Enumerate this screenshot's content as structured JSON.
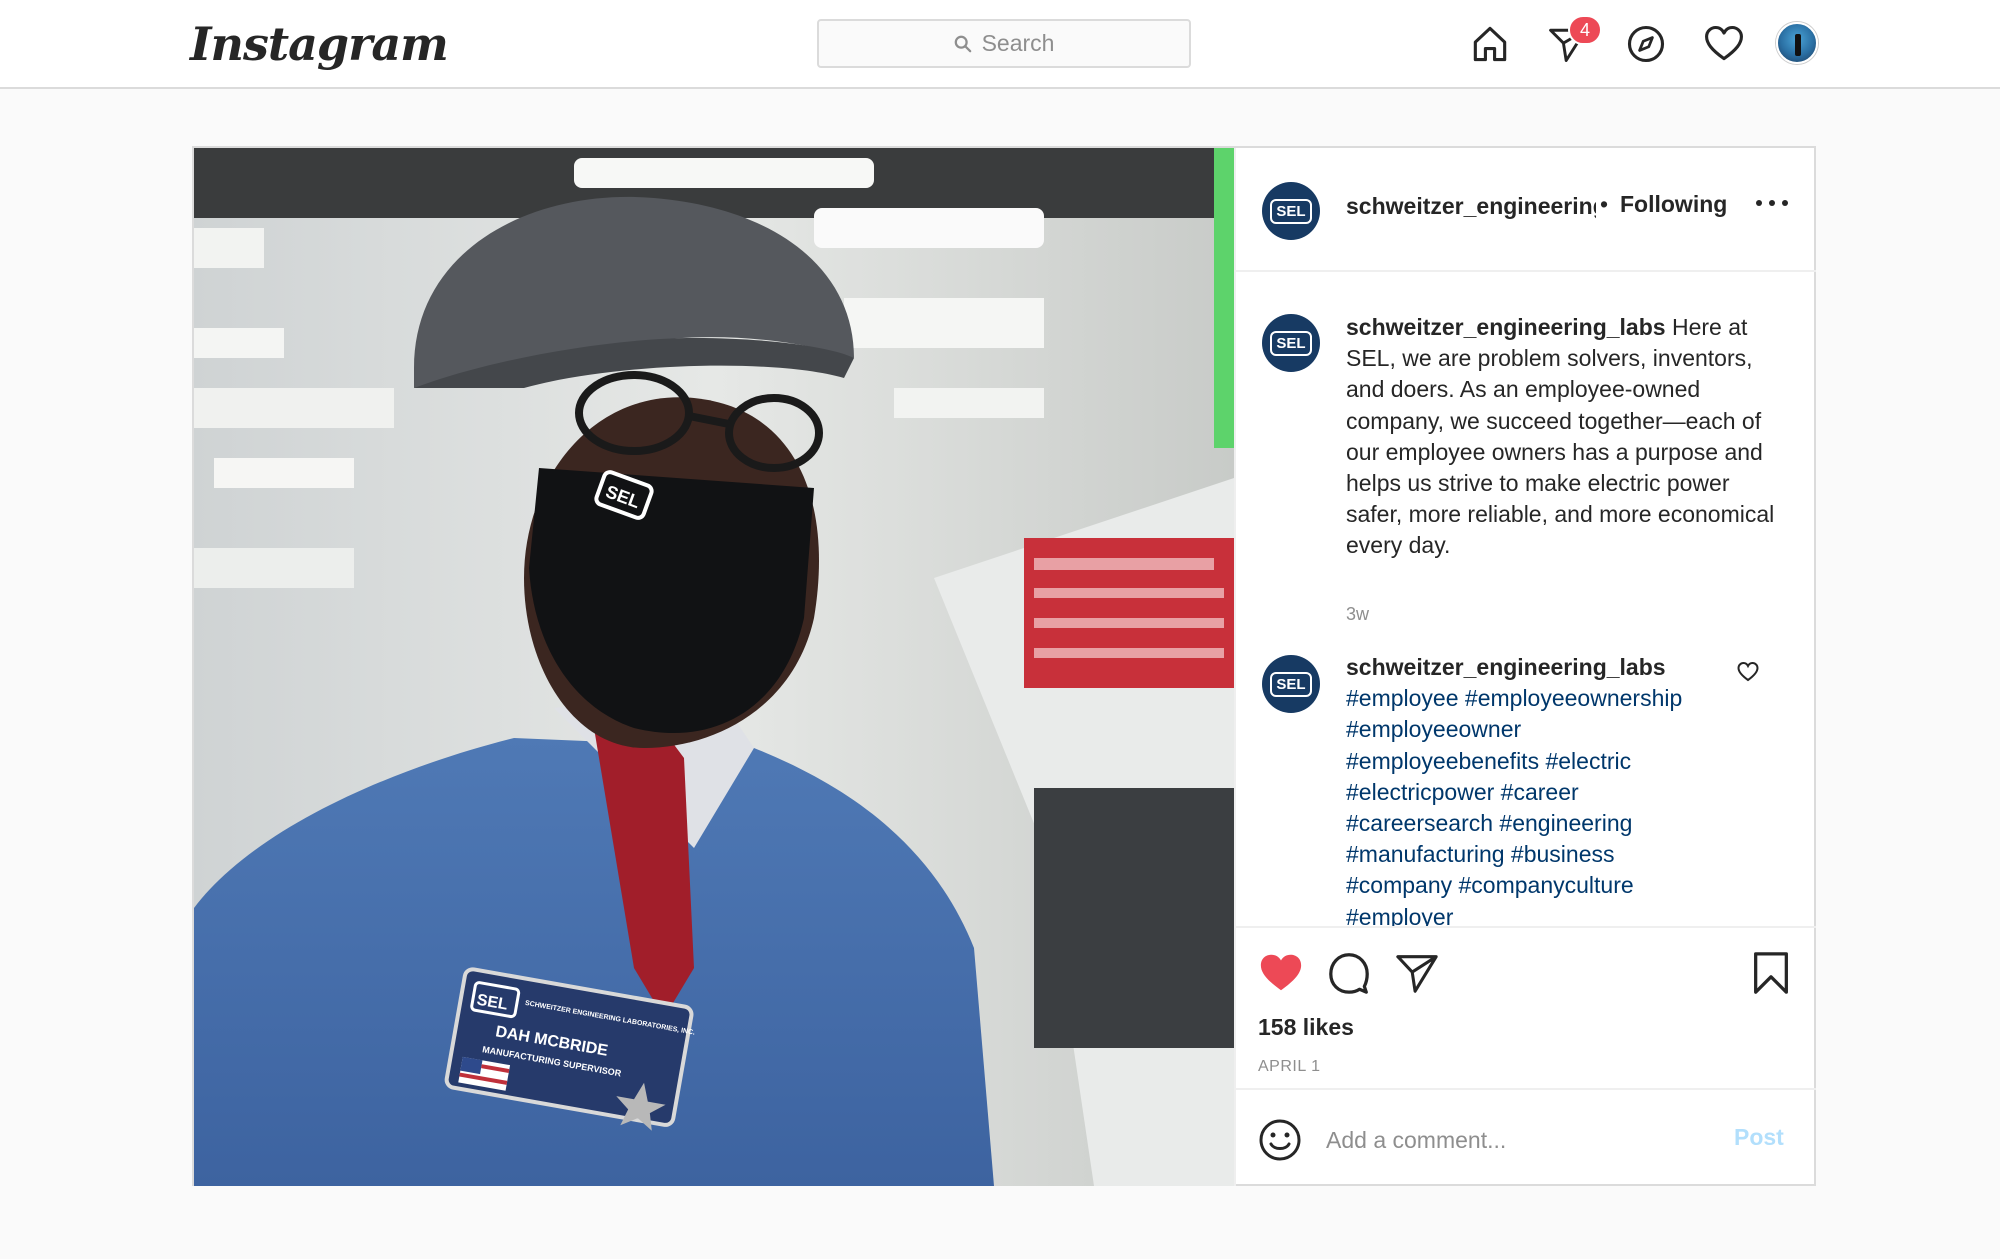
{
  "header": {
    "logo_text": "Instagram",
    "search_placeholder": "Search",
    "icons": [
      "home-icon",
      "direct-message-icon",
      "explore-icon",
      "activity-heart-icon",
      "profile-avatar"
    ],
    "message_badge": "4"
  },
  "post": {
    "username_truncated": "schweitzer_engineerinɡ",
    "separator": "•",
    "follow_status": "Following",
    "avatar_text": "SEL",
    "caption": {
      "username": "schweitzer_engineering_labs",
      "text": "Here at SEL, we are problem solvers, inventors, and doers. As an employee-owned company, we succeed together—each of our employee owners has a purpose and helps us strive to make electric power safer, more reliable, and more economical every day.",
      "time": "3w"
    },
    "hashtag_comment": {
      "username": "schweitzer_engineering_labs",
      "lines": [
        "#employee #employeeownership",
        "#employeeowner",
        "#employeebenefits #electric",
        "#electricpower #career",
        "#careersearch #engineering",
        "#manufacturing #business",
        "#company #companyculture",
        "#employer"
      ]
    },
    "likes": "158 likes",
    "date": "APRIL 1",
    "liked": true,
    "comment_placeholder": "Add a comment...",
    "post_button": "Post",
    "photo_badge": {
      "mask_logo": "SEL",
      "badge_logo": "SEL",
      "badge_company": "SCHWEITZER ENGINEERING LABORATORIES, INC.",
      "badge_name": "DAH MCBRIDE",
      "badge_title": "MANUFACTURING SUPERVISOR"
    }
  },
  "colors": {
    "like_red": "#ed4956",
    "hashtag_blue": "#00376b",
    "post_button_disabled": "#b2dffc",
    "sel_navy": "#173a63"
  }
}
